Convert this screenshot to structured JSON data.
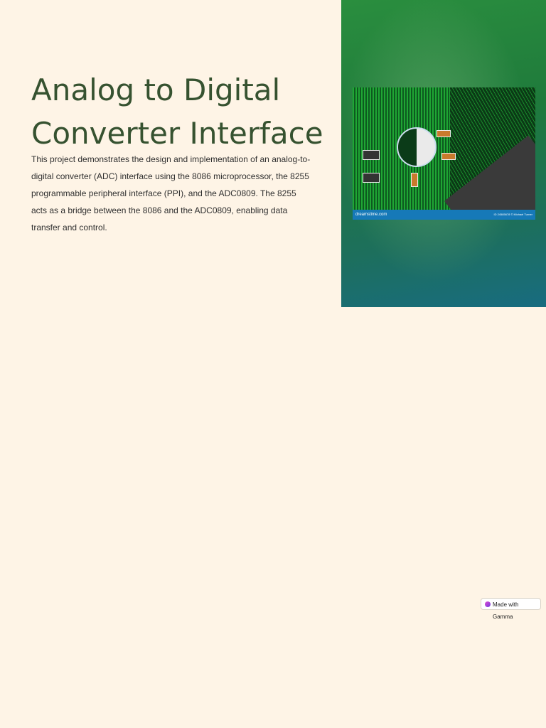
{
  "slide": {
    "title": "Analog to Digital Converter Interface",
    "description": " This project demonstrates the design and implementation of an analog-to-digital converter (ADC) interface using the 8086 microprocessor, the 8255 programmable peripheral interface (PPI), and the ADC0809. The 8255 acts as a bridge between the 8086 and the ADC0809, enabling data transfer and control."
  },
  "image": {
    "watermark_left": "dreamstime.com",
    "watermark_right": "ID 24585678 © Michael Turner"
  },
  "badge": {
    "label": "Made with Gamma"
  },
  "colors": {
    "background": "#fef4e6",
    "title": "#365230",
    "panel": "#1f7a3c"
  }
}
